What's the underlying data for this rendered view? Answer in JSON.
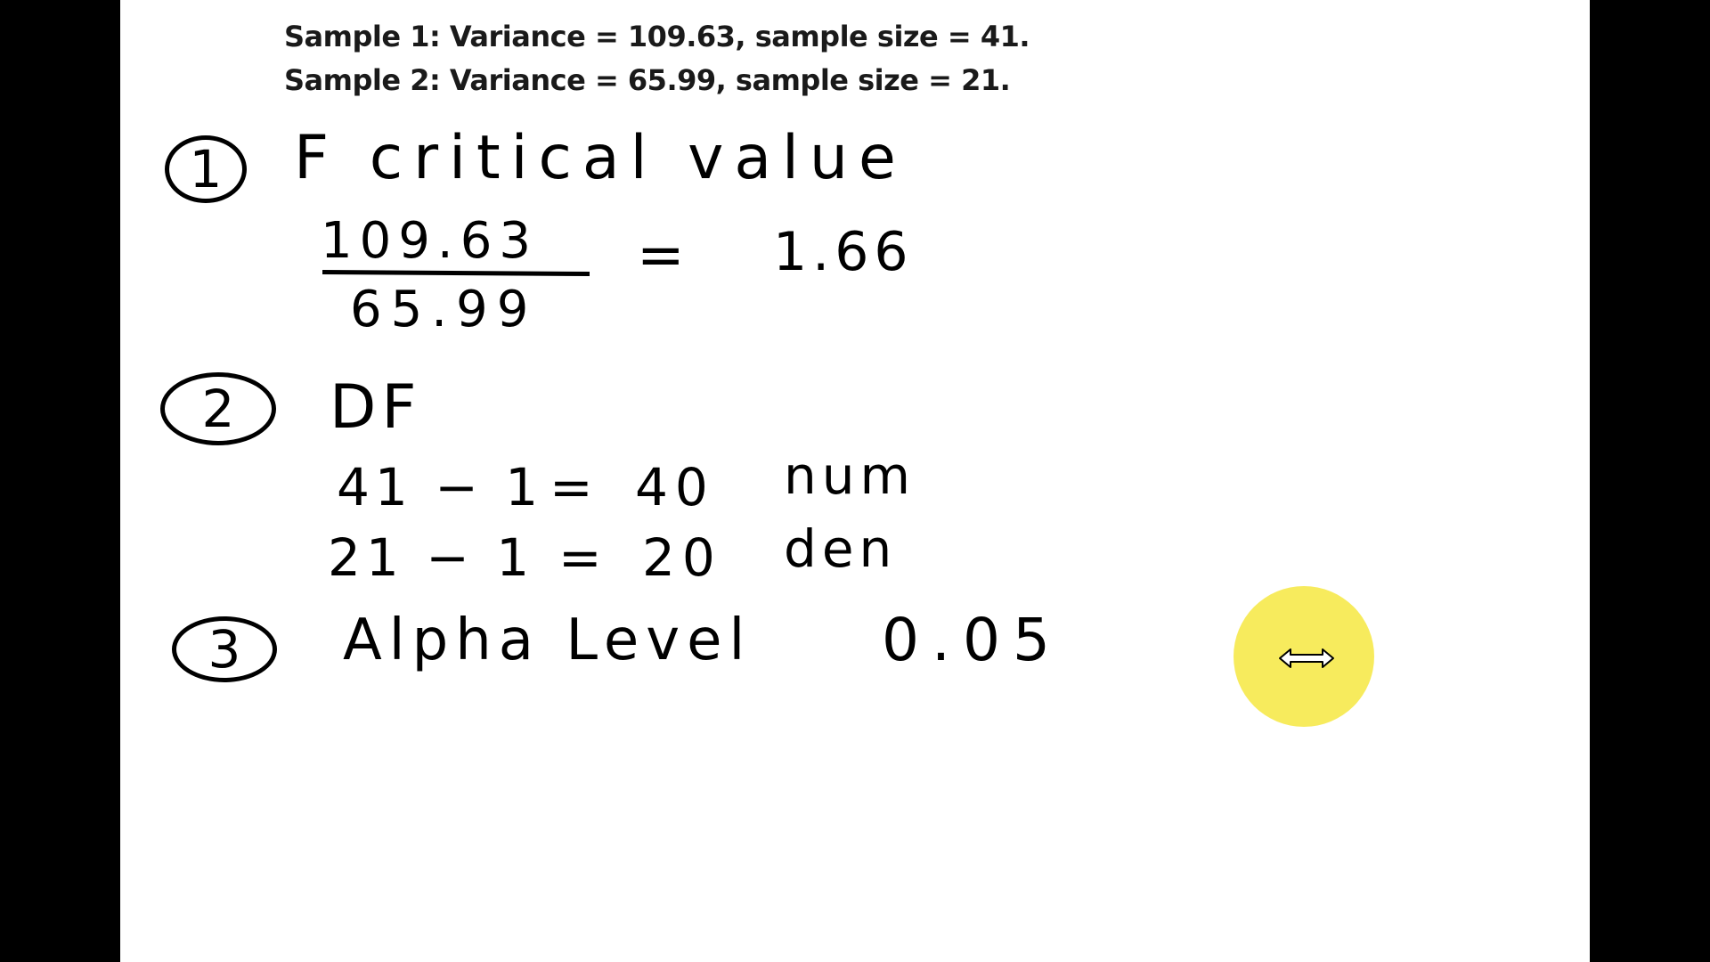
{
  "header": {
    "line1": "Sample 1: Variance = 109.63, sample size = 41.",
    "line2": "Sample 2: Variance = 65.99, sample size = 21."
  },
  "step1": {
    "number": "1",
    "title": "F critical value",
    "numerator": "109.63",
    "denominator": "65.99",
    "equals": "=",
    "result": "1.66"
  },
  "step2": {
    "number": "2",
    "title": "DF",
    "row1": {
      "expr": "41 − 1",
      "equals": "=",
      "value": "40",
      "label": "num"
    },
    "row2": {
      "expr": "21 − 1",
      "equals": "=",
      "value": "20",
      "label": "den"
    }
  },
  "step3": {
    "number": "3",
    "title": "Alpha Level",
    "value": "0.05"
  },
  "cursor": {
    "icon": "resize-horizontal-icon",
    "highlight_color": "#f6e94f"
  }
}
